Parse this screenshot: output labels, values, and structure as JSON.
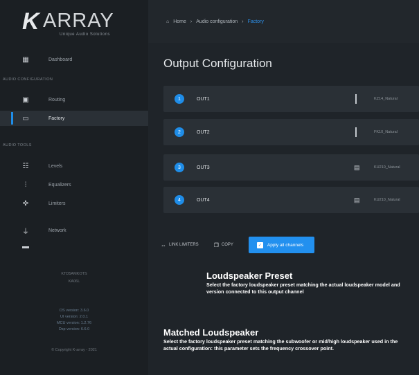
{
  "brand": {
    "mark": "K",
    "name": "ARRAY",
    "tagline": "Unique Audio Solutions"
  },
  "sidebar": {
    "dashboard": "Dashboard",
    "section_audio_config": "AUDIO CONFIGURATION",
    "routing": "Routing",
    "factory": "Factory",
    "section_audio_tools": "AUDIO TOOLS",
    "levels": "Levels",
    "equalizers": "Equalizers",
    "limiters": "Limiters",
    "network": "Network",
    "device_id": "KTD5AMKOTS",
    "device_model": "KA06L",
    "versions": [
      "OS version: 3.6.0",
      "UI version: 2.0.1",
      "MCU version: 1.2.76",
      "Dsp version: 6.6.0"
    ],
    "copyright": "© Copyright K-array - 2021"
  },
  "header": {
    "crumbs": [
      "Home",
      "Audio configuration",
      "Factory"
    ],
    "separator": "›"
  },
  "main": {
    "title": "Output Configuration",
    "outputs": [
      {
        "num": "1",
        "name": "OUT1",
        "preset": "KZ14_Natural"
      },
      {
        "num": "2",
        "name": "OUT2",
        "preset": "FK10_Natural"
      },
      {
        "num": "3",
        "name": "OUT3",
        "preset": "KU210_Natural"
      },
      {
        "num": "4",
        "name": "OUT4",
        "preset": "KU210_Natural"
      }
    ],
    "link_limiters": "LINK LIMITERS",
    "copy": "COPY",
    "apply_all": "Apply all channels"
  },
  "tooltips": {
    "preset_title": "Loudspeaker Preset",
    "preset_desc": "Select the factory loudspeaker preset matching the actual loudspeaker model and version connected to this output channel",
    "matched_title": "Matched Loudspeaker",
    "matched_desc": "Select the factory loudspeaker preset matching the subwoofer or mid/high loudspeaker used in the actual configuration: this parameter sets the frequency crossover point."
  },
  "icons": {
    "dashboard": "dashboard-icon",
    "routing": "routing-icon",
    "factory": "factory-icon",
    "levels": "levels-icon",
    "equalizers": "equalizer-icon",
    "limiters": "limiter-icon",
    "network": "network-icon",
    "home": "home-icon",
    "link": "link-icon",
    "copy": "copy-icon",
    "apply": "apply-icon",
    "speaker": "speaker-icon"
  },
  "colors": {
    "accent": "#1f8de8",
    "sidebar_bg": "#1b1f23",
    "main_bg": "#1f2429",
    "row_bg": "#2a3036"
  }
}
